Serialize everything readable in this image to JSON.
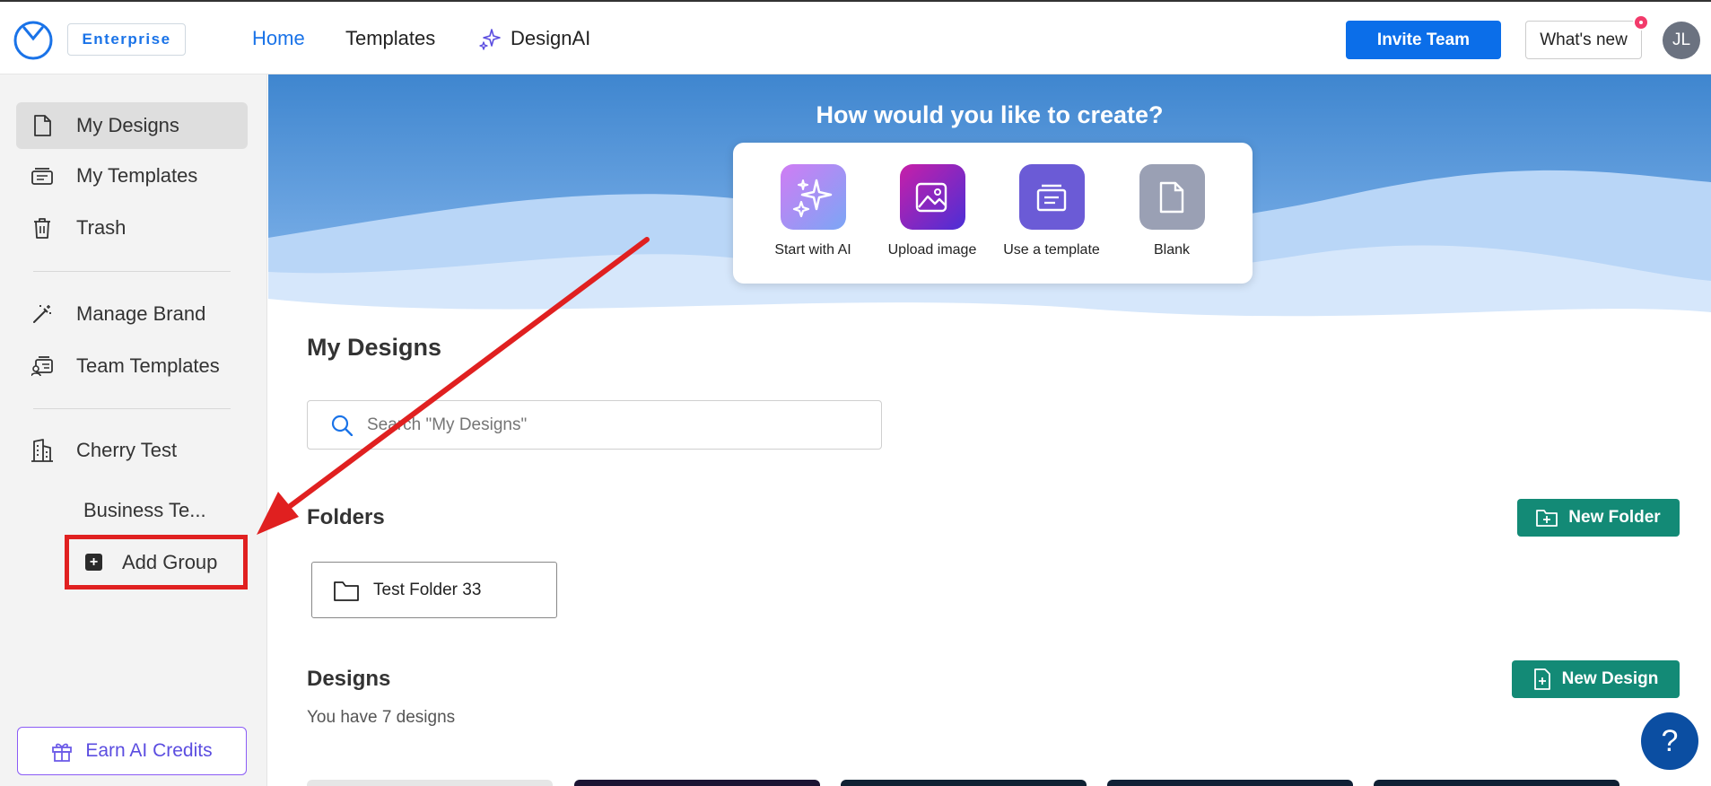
{
  "header": {
    "badge": "Enterprise",
    "nav": {
      "home": "Home",
      "templates": "Templates",
      "designai": "DesignAI"
    },
    "invite_label": "Invite Team",
    "whatsnew_label": "What's new",
    "avatar_initials": "JL"
  },
  "sidebar": {
    "items": [
      {
        "label": "My Designs",
        "icon": "document-icon",
        "active": true
      },
      {
        "label": "My Templates",
        "icon": "templates-icon"
      },
      {
        "label": "Trash",
        "icon": "trash-icon"
      },
      {
        "label": "Manage Brand",
        "icon": "magic-wand-icon"
      },
      {
        "label": "Team Templates",
        "icon": "team-templates-icon"
      },
      {
        "label": "Cherry Test",
        "icon": "building-icon"
      }
    ],
    "sub_item": "Business Te...",
    "add_group_label": "Add Group",
    "earn_label": "Earn AI Credits"
  },
  "hero": {
    "title": "How would you like to create?",
    "options": [
      {
        "label": "Start with AI",
        "icon": "sparkle-icon",
        "color": "#b86cf0"
      },
      {
        "label": "Upload image",
        "icon": "image-upload-icon",
        "color": "#a323c6"
      },
      {
        "label": "Use a template",
        "icon": "template-icon",
        "color": "#6b5bd6"
      },
      {
        "label": "Blank",
        "icon": "blank-page-icon",
        "color": "#9aa0b4"
      }
    ]
  },
  "main": {
    "section_title": "My Designs",
    "search_placeholder": "Search \"My Designs\"",
    "folders_title": "Folders",
    "new_folder_label": "New Folder",
    "folders": [
      "Test Folder 33"
    ],
    "designs_title": "Designs",
    "designs_count": "You have 7 designs",
    "new_design_label": "New Design",
    "help_label": "?"
  },
  "colors": {
    "accent": "#0b6ee9",
    "teal": "#138a76",
    "annotation": "#e02020"
  }
}
